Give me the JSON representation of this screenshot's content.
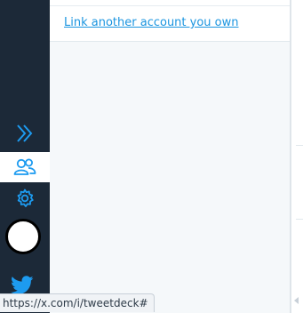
{
  "panel": {
    "link_label": "Link another account you own"
  },
  "sidebar": {
    "items": [
      {
        "name": "expand",
        "icon": "double-chevron-right-icon"
      },
      {
        "name": "accounts",
        "icon": "accounts-icon",
        "active": true
      },
      {
        "name": "settings",
        "icon": "gear-icon"
      },
      {
        "name": "avatar",
        "icon": "avatar"
      },
      {
        "name": "twitter",
        "icon": "twitter-bird-icon"
      }
    ]
  },
  "status_bar": {
    "url": "https://x.com/i/tweetdeck#"
  },
  "colors": {
    "sidebar_bg": "#1c2938",
    "accent": "#1d9bf0",
    "link": "#1b95e0",
    "panel_bg": "#f5f8fa"
  }
}
